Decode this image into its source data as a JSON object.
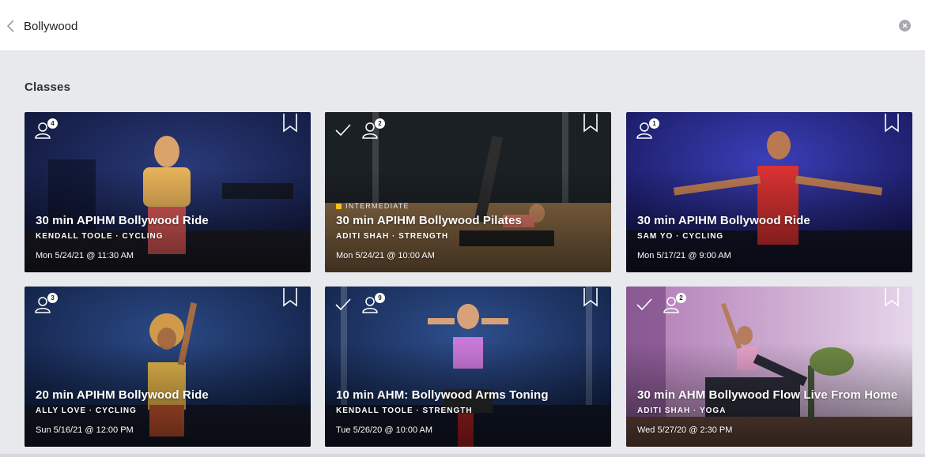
{
  "search": {
    "value": "Bollywood",
    "placeholder": "Search"
  },
  "icons": {
    "back": "chevron-left-icon",
    "clear": "clear-circle-icon",
    "bookmark": "bookmark-icon",
    "completed": "checkmark-icon",
    "taken": "person-icon"
  },
  "colors": {
    "level_indicator": "#f5c518",
    "background": "#e8e9ed"
  },
  "section": {
    "title": "Classes"
  },
  "classes": [
    {
      "title": "30 min APIHM Bollywood Ride",
      "instructor": "KENDALL TOOLE",
      "separator": "·",
      "category": "CYCLING",
      "date": "Mon 5/24/21 @ 11:30 AM",
      "taken_count": "4",
      "completed": false,
      "level": ""
    },
    {
      "title": "30 min APIHM Bollywood Pilates",
      "instructor": "ADITI SHAH",
      "separator": "·",
      "category": "STRENGTH",
      "date": "Mon 5/24/21 @ 10:00 AM",
      "taken_count": "2",
      "completed": true,
      "level": "INTERMEDIATE"
    },
    {
      "title": "30 min APIHM Bollywood Ride",
      "instructor": "SAM YO",
      "separator": "·",
      "category": "CYCLING",
      "date": "Mon 5/17/21 @ 9:00 AM",
      "taken_count": "1",
      "completed": false,
      "level": ""
    },
    {
      "title": "20 min APIHM Bollywood Ride",
      "instructor": "ALLY LOVE",
      "separator": "·",
      "category": "CYCLING",
      "date": "Sun 5/16/21 @ 12:00 PM",
      "taken_count": "3",
      "completed": false,
      "level": ""
    },
    {
      "title": "10 min AHM: Bollywood Arms Toning",
      "instructor": "KENDALL TOOLE",
      "separator": "·",
      "category": "STRENGTH",
      "date": "Tue 5/26/20 @ 10:00 AM",
      "taken_count": "9",
      "completed": true,
      "level": ""
    },
    {
      "title": "30 min AHM Bollywood Flow Live From Home",
      "instructor": "ADITI SHAH",
      "separator": "·",
      "category": "YOGA",
      "date": "Wed 5/27/20 @ 2:30 PM",
      "taken_count": "2",
      "completed": true,
      "level": ""
    }
  ]
}
